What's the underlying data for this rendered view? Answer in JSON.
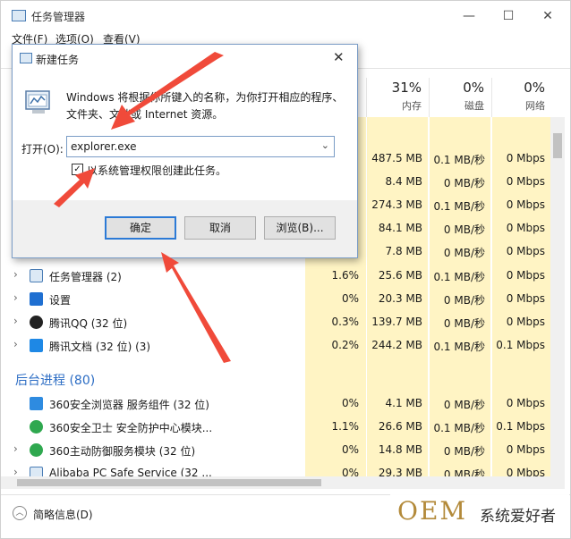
{
  "window": {
    "title": "任务管理器",
    "menus": [
      "文件(F)",
      "选项(O)",
      "查看(V)"
    ],
    "controls": [
      "—",
      "☐",
      "✕"
    ]
  },
  "columns": [
    {
      "pct": "31%",
      "name": "内存"
    },
    {
      "pct": "0%",
      "name": "磁盘"
    },
    {
      "pct": "0%",
      "name": "网络"
    }
  ],
  "rows": [
    {
      "cpu": "",
      "mem": "487.5 MB",
      "disk": "0.1 MB/秒",
      "net": "0 Mbps"
    },
    {
      "cpu": "",
      "mem": "8.4 MB",
      "disk": "0 MB/秒",
      "net": "0 Mbps"
    },
    {
      "cpu": "",
      "mem": "274.3 MB",
      "disk": "0.1 MB/秒",
      "net": "0 Mbps"
    },
    {
      "cpu": "",
      "mem": "84.1 MB",
      "disk": "0 MB/秒",
      "net": "0 Mbps"
    },
    {
      "cpu": "",
      "mem": "7.8 MB",
      "disk": "0 MB/秒",
      "net": "0 Mbps"
    },
    {
      "name": "任务管理器 (2)",
      "cpu": "1.6%",
      "mem": "25.6 MB",
      "disk": "0.1 MB/秒",
      "net": "0 Mbps"
    },
    {
      "name": "设置",
      "cpu": "0%",
      "mem": "20.3 MB",
      "disk": "0 MB/秒",
      "net": "0 Mbps"
    },
    {
      "name": "腾讯QQ (32 位)",
      "cpu": "0.3%",
      "mem": "139.7 MB",
      "disk": "0 MB/秒",
      "net": "0 Mbps"
    },
    {
      "name": "腾讯文档 (32 位) (3)",
      "cpu": "0.2%",
      "mem": "244.2 MB",
      "disk": "0.1 MB/秒",
      "net": "0.1 Mbps"
    }
  ],
  "background_section": "后台进程 (80)",
  "bg_rows": [
    {
      "name": "360安全浏览器 服务组件 (32 位)",
      "cpu": "0%",
      "mem": "4.1 MB",
      "disk": "0 MB/秒",
      "net": "0 Mbps"
    },
    {
      "name": "360安全卫士 安全防护中心模块...",
      "cpu": "1.1%",
      "mem": "26.6 MB",
      "disk": "0.1 MB/秒",
      "net": "0.1 Mbps"
    },
    {
      "name": "360主动防御服务模块 (32 位)",
      "cpu": "0%",
      "mem": "14.8 MB",
      "disk": "0 MB/秒",
      "net": "0 Mbps"
    },
    {
      "name": "Alibaba PC Safe Service (32 ...",
      "cpu": "0%",
      "mem": "29.3 MB",
      "disk": "0 MB/秒",
      "net": "0 Mbps"
    }
  ],
  "footer": {
    "label": "简略信息(D)"
  },
  "watermark": {
    "oem": "OEM",
    "text": "系统爱好者"
  },
  "dialog": {
    "title": "新建任务",
    "close": "✕",
    "description": "Windows 将根据你所键入的名称，为你打开相应的程序、文件夹、文档或 Internet 资源。",
    "open_label": "打开(O):",
    "open_value": "explorer.exe",
    "checkbox_label": "以系统管理权限创建此任务。",
    "checkbox_mark": "✓",
    "ok": "确定",
    "cancel": "取消",
    "browse": "浏览(B)..."
  },
  "colors": {
    "highlight": "#fff4c4",
    "accent": "#2b6cc4",
    "arrow": "#f04a3a"
  }
}
